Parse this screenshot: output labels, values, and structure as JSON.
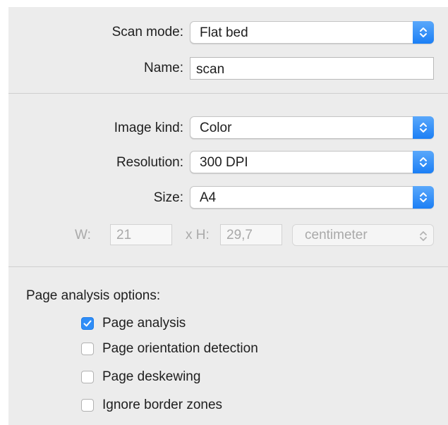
{
  "scanner": {
    "scan_mode": {
      "label": "Scan mode:",
      "value": "Flat bed"
    },
    "name": {
      "label": "Name:",
      "value": "scan"
    }
  },
  "image": {
    "image_kind": {
      "label": "Image kind:",
      "value": "Color"
    },
    "resolution": {
      "label": "Resolution:",
      "value": "300 DPI"
    },
    "size": {
      "label": "Size:",
      "value": "A4"
    },
    "width": {
      "label": "W:",
      "value": "21"
    },
    "height": {
      "label": "x H:",
      "value": "29,7"
    },
    "unit": {
      "value": "centimeter"
    }
  },
  "page_analysis": {
    "title": "Page analysis options:",
    "options": [
      {
        "label": "Page analysis",
        "checked": true
      },
      {
        "label": "Page orientation detection",
        "checked": false
      },
      {
        "label": "Page deskewing",
        "checked": false
      },
      {
        "label": "Ignore border zones",
        "checked": false
      }
    ]
  },
  "colors": {
    "accent": "#2f8df7",
    "panel_background": "#ececec"
  }
}
